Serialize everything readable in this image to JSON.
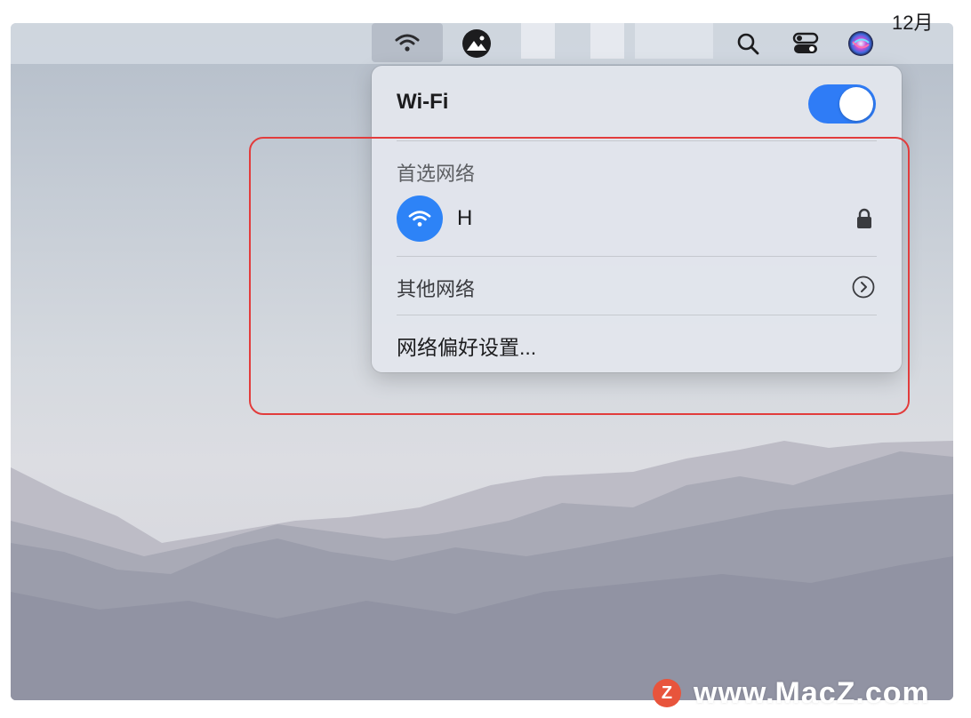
{
  "menubar": {
    "clock_text": "12月",
    "icons": [
      "wifi-icon",
      "photo-icon",
      "search-icon",
      "control-center-icon",
      "siri-icon"
    ]
  },
  "wifi_menu": {
    "title": "Wi-Fi",
    "toggle_on": true,
    "preferred_header": "首选网络",
    "network": {
      "name": "H",
      "locked": true
    },
    "other_networks_label": "其他网络",
    "preferences_label": "网络偏好设置..."
  },
  "watermark": {
    "logo_letter": "Z",
    "text": "www.MacZ.com"
  },
  "colors": {
    "accent": "#2f7cf6",
    "highlight": "#e23c3c",
    "watermark_logo": "#e8543c"
  }
}
